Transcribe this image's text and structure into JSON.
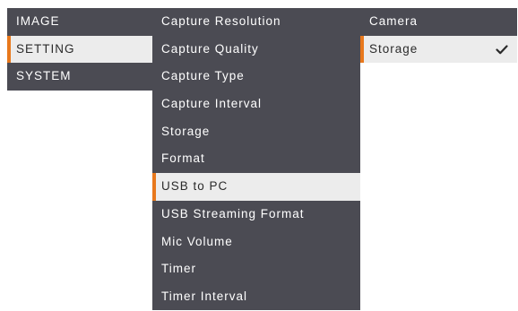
{
  "menu": {
    "col1": [
      "IMAGE",
      "SETTING",
      "SYSTEM"
    ],
    "col2": [
      "Capture Resolution",
      "Capture Quality",
      "Capture Type",
      "Capture Interval",
      "Storage",
      "Format",
      "USB to PC",
      "USB Streaming Format",
      "Mic Volume",
      "Timer",
      "Timer Interval"
    ],
    "col3": [
      "Camera",
      "Storage"
    ]
  },
  "selected": {
    "col1": "SETTING",
    "col2": "USB to PC",
    "col3": "Storage"
  },
  "icons": {
    "checked": "check-icon"
  },
  "colors": {
    "menu_bg": "#4b4b53",
    "selected_bg": "#ececec",
    "accent": "#e8781c",
    "text": "#ffffff",
    "selected_text": "#2b2b2b"
  }
}
